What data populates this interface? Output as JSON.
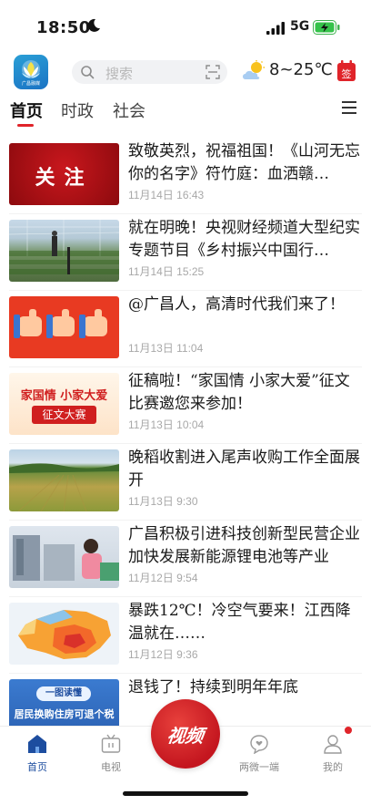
{
  "status_bar": {
    "time": "18:50",
    "network": "5G"
  },
  "header": {
    "logo_label": "广昌融媒",
    "search_placeholder": "搜索",
    "temperature": "8~25℃",
    "sign_label": "签"
  },
  "tabs": [
    {
      "label": "首页",
      "active": true
    },
    {
      "label": "时政",
      "active": false
    },
    {
      "label": "社会",
      "active": false
    }
  ],
  "news": [
    {
      "title": "致敬英烈，祝福祖国！《山河无忘 你的名字》符竹庭：血洒赣…",
      "time": "11月14日 16:43",
      "thumb_text": "关注"
    },
    {
      "title": "就在明晚！央视财经频道大型纪实专题节目《乡村振兴中国行…",
      "time": "11月14日 15:25"
    },
    {
      "title": "@广昌人，高清时代我们来了！",
      "time": "11月13日 11:04"
    },
    {
      "title": "征稿啦！“家国情 小家大爱”征文比赛邀您来参加！",
      "time": "11月13日 10:04",
      "thumb_line1": "家国情 小家大爱",
      "thumb_line2": "征文大赛"
    },
    {
      "title": "晚稻收割进入尾声收购工作全面展开",
      "time": "11月13日 9:30"
    },
    {
      "title": "广昌积极引进科技创新型民营企业 加快发展新能源锂电池等产业",
      "time": "11月12日 9:54"
    },
    {
      "title": "暴跌12℃！冷空气要来！江西降温就在……",
      "time": "11月12日 9:36"
    },
    {
      "title": "退钱了！持续到明年年底",
      "time": "",
      "thumb_line1": "一图读懂",
      "thumb_line2": "居民换购住房可退个税"
    }
  ],
  "bottom_nav": {
    "home": "首页",
    "tv": "电视",
    "video": "视频",
    "microsite": "两微一端",
    "mine": "我的"
  },
  "colors": {
    "accent": "#e0242a",
    "nav_active": "#1d4d9f",
    "muted": "#a8a8a8"
  }
}
